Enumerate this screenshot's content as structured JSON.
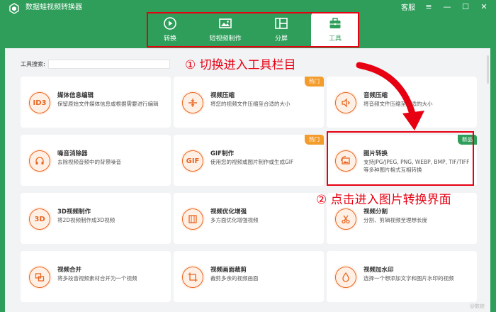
{
  "app": {
    "title": "数据蛙视频转换器"
  },
  "window": {
    "service_label": "客服"
  },
  "tabs": [
    {
      "label": "转换",
      "icon": "convert-icon"
    },
    {
      "label": "短视频制作",
      "icon": "short-video-icon"
    },
    {
      "label": "分屏",
      "icon": "split-screen-icon"
    },
    {
      "label": "工具",
      "icon": "toolbox-icon",
      "active": true
    }
  ],
  "search": {
    "label": "工具搜索:",
    "value": ""
  },
  "annotations": {
    "step1": "① 切换进入工具栏目",
    "step2": "② 点击进入图片转换界面",
    "color": "#e60012"
  },
  "tools": [
    {
      "title": "媒体信息编辑",
      "desc": "保留原始文件媒体信息或根据需要进行编辑",
      "icon": "id3-icon",
      "glyph": "ID3"
    },
    {
      "title": "视频压缩",
      "desc": "将您的视频文件压缩至合适的大小",
      "icon": "compress-icon",
      "badge": "热门"
    },
    {
      "title": "音频压缩",
      "desc": "将音频文件压缩至合适的大小",
      "icon": "audio-compress-icon"
    },
    {
      "title": "噪音消除器",
      "desc": "去除视频音频中的背景噪音",
      "icon": "headphones-icon"
    },
    {
      "title": "GIF制作",
      "desc": "使用您的视频或图片制作或生成GIF",
      "icon": "gif-icon",
      "glyph": "GIF",
      "badge": "热门"
    },
    {
      "title": "图片转换",
      "desc": "支持JPG/JPEG, PNG, WEBP, BMP, TIF/TIFF等多种图片格式互相转换",
      "icon": "image-convert-icon",
      "badge": "新品"
    },
    {
      "title": "3D视频制作",
      "desc": "将2D视频制作成3D视频",
      "icon": "3d-icon",
      "glyph": "3D"
    },
    {
      "title": "视频优化增强",
      "desc": "多方面优化增强视频",
      "icon": "enhance-icon"
    },
    {
      "title": "视频分割",
      "desc": "分割、剪辑视频至理想长度",
      "icon": "scissors-icon"
    },
    {
      "title": "视频合并",
      "desc": "将多段音视频素材合并为一个视频",
      "icon": "merge-icon"
    },
    {
      "title": "视频画面裁剪",
      "desc": "裁剪多余的视频画面",
      "icon": "crop-icon"
    },
    {
      "title": "视频加水印",
      "desc": "选择一个想添加文字和图片水印的视频",
      "icon": "watermark-icon"
    }
  ],
  "colors": {
    "brand": "#2f9e5a",
    "accent": "#e8651f",
    "hot": "#f39c2c"
  },
  "watermark": "@数蛙"
}
